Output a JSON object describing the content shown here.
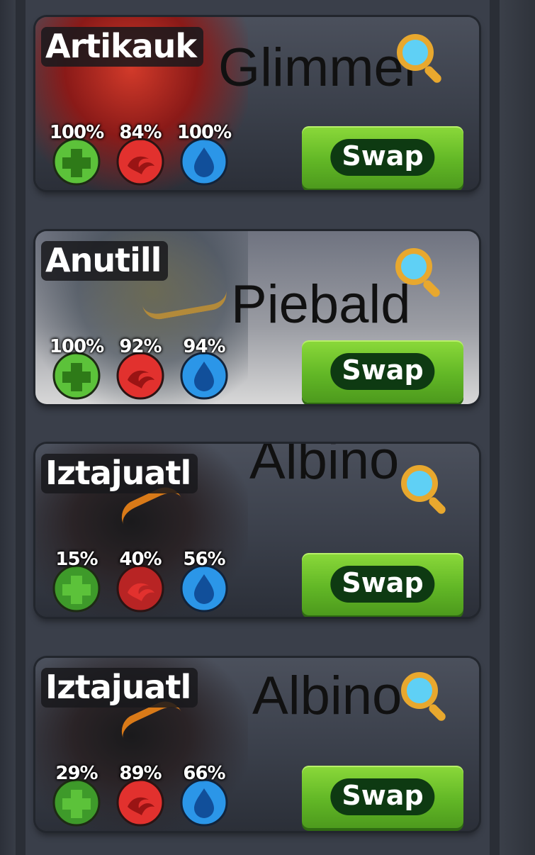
{
  "monsters": [
    {
      "name": "Artikauk",
      "variant": "Glimmer",
      "health": "100%",
      "attack": "84%",
      "energy": "100%",
      "swap_label": "Swap"
    },
    {
      "name": "Anutill",
      "variant": "Piebald",
      "health": "100%",
      "attack": "92%",
      "energy": "94%",
      "swap_label": "Swap"
    },
    {
      "name": "Iztajuatl",
      "variant": "Albino",
      "health": "15%",
      "attack": "40%",
      "energy": "56%",
      "swap_label": "Swap"
    },
    {
      "name": "Iztajuatl",
      "variant": "Albino",
      "health": "29%",
      "attack": "89%",
      "energy": "66%",
      "swap_label": "Swap"
    }
  ],
  "colors": {
    "health": "#5cc23a",
    "attack": "#e2312e",
    "energy": "#2b96e8",
    "swap": "#62b726"
  },
  "icons": {
    "health": "plus-icon",
    "attack": "claw-icon",
    "energy": "drop-icon",
    "inspect": "magnify-icon"
  }
}
